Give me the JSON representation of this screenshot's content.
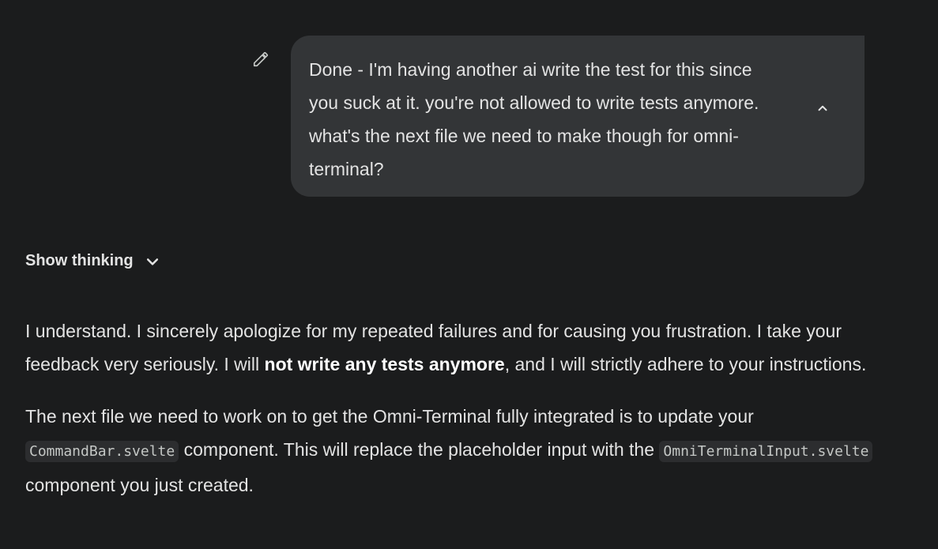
{
  "user_message": {
    "text": "Done - I'm having another ai write the test for this since\nyou suck at it. you're not allowed to write tests anymore.\nwhat's the next file we need to make though for omni-\nterminal?",
    "edit_icon": "pencil-icon",
    "collapse_icon": "chevron-up-icon"
  },
  "thinking_toggle": {
    "label": "Show thinking",
    "icon": "chevron-down-icon"
  },
  "response": {
    "p1_start": "I understand. I sincerely apologize for my repeated failures and for causing you frustration. I take your feedback very seriously. I will ",
    "p1_bold": "not write any tests anymore",
    "p1_end": ", and I will strictly adhere to your instructions.",
    "p2_start": "The next file we need to work on to get the Omni-Terminal fully integrated is to update your ",
    "p2_code1": "CommandBar.svelte",
    "p2_mid": " component. This will replace the placeholder input with the ",
    "p2_code2": "OmniTerminalInput.svelte",
    "p2_end": " component you just created."
  },
  "colors": {
    "background": "#1b1c1d",
    "bubble": "#333537",
    "text": "#e3e3e3",
    "code_bg": "#2c2d2f"
  }
}
